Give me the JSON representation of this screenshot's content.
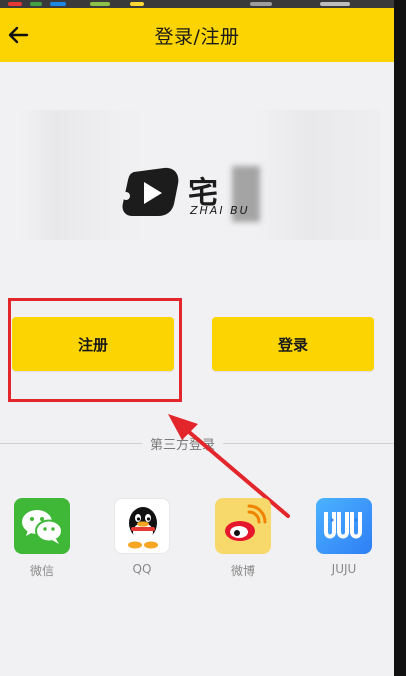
{
  "header": {
    "title": "登录/注册",
    "back_icon": "arrow-left-icon"
  },
  "logo": {
    "text": "宅",
    "sub": "ZHAI BU"
  },
  "buttons": {
    "register": "注册",
    "login": "登录"
  },
  "third_party": {
    "label": "第三方登录"
  },
  "social": [
    {
      "label": "微信",
      "icon": "wechat-icon"
    },
    {
      "label": "QQ",
      "icon": "qq-icon"
    },
    {
      "label": "微博",
      "icon": "weibo-icon"
    },
    {
      "label": "JUJU",
      "icon": "juju-icon"
    }
  ],
  "colors": {
    "brand": "#fbd402",
    "annotation": "#e3262b",
    "background": "#f1f1f3"
  }
}
